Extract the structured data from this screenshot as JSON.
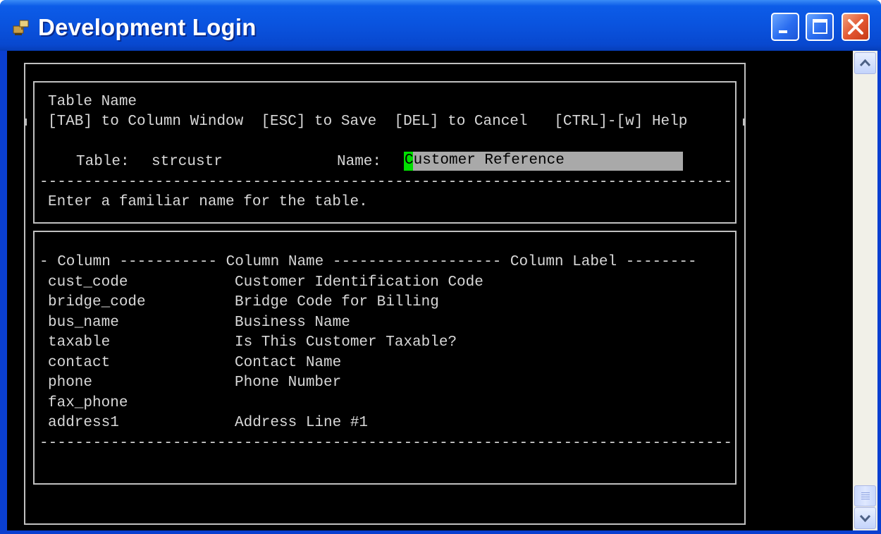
{
  "window": {
    "title": "Development Login",
    "icon": "app-icon",
    "controls": [
      "minimize-icon",
      "maximize-icon",
      "close-icon"
    ]
  },
  "form": {
    "heading": "Table Name",
    "help_line": "[TAB] to Column Window  [ESC] to Save  [DEL] to Cancel   [CTRL]-[w] Help",
    "table_label": "Table:",
    "table_value": "strcustr",
    "name_label": "Name:",
    "name_value": "Customer Reference",
    "divider": "------------------------------------------------------------------------------",
    "hint": "Enter a familiar name for the table."
  },
  "columns": {
    "header": "- Column ----------- Column Name ------------------- Column Label --------",
    "rows": [
      {
        "column": "cust_code",
        "name": "Customer Identification Code"
      },
      {
        "column": "bridge_code",
        "name": "Bridge Code for Billing"
      },
      {
        "column": "bus_name",
        "name": "Business Name"
      },
      {
        "column": "taxable",
        "name": "Is This Customer Taxable?"
      },
      {
        "column": "contact",
        "name": "Contact Name"
      },
      {
        "column": "phone",
        "name": "Phone Number"
      },
      {
        "column": "fax_phone",
        "name": ""
      },
      {
        "column": "address1",
        "name": "Address Line #1"
      }
    ],
    "footer": "------------------------------------------------------------------------------"
  },
  "colors": {
    "titlebar": "#0a53de",
    "console_bg": "#000000",
    "console_text": "#d8d8d8",
    "field_bg": "#a9a9a9",
    "cursor": "#00e000"
  }
}
